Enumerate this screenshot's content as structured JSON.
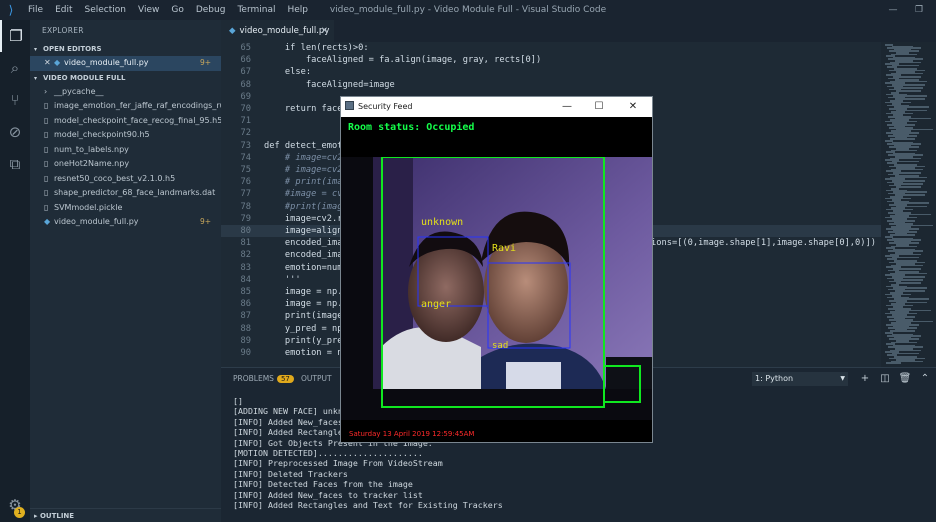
{
  "window": {
    "title": "video_module_full.py - Video Module Full - Visual Studio Code",
    "menu": [
      "File",
      "Edit",
      "Selection",
      "View",
      "Go",
      "Debug",
      "Terminal",
      "Help"
    ]
  },
  "sidebar": {
    "title": "EXPLORER",
    "open_editors_label": "OPEN EDITORS",
    "open_editor": {
      "name": "video_module_full.py",
      "badge": "9+"
    },
    "project_label": "VIDEO MODULE FULL",
    "items": [
      {
        "name": "__pycache__",
        "folder": true,
        "badge": ""
      },
      {
        "name": "image_emotion_fer_jaffe_raf_encodings_rus_4...",
        "folder": false,
        "badge": ""
      },
      {
        "name": "model_checkpoint_face_recog_final_95.h5",
        "folder": false,
        "badge": ""
      },
      {
        "name": "model_checkpoint90.h5",
        "folder": false,
        "badge": ""
      },
      {
        "name": "num_to_labels.npy",
        "folder": false,
        "badge": ""
      },
      {
        "name": "oneHot2Name.npy",
        "folder": false,
        "badge": ""
      },
      {
        "name": "resnet50_coco_best_v2.1.0.h5",
        "folder": false,
        "badge": ""
      },
      {
        "name": "shape_predictor_68_face_landmarks.dat",
        "folder": false,
        "badge": ""
      },
      {
        "name": "SVMmodel.pickle",
        "folder": false,
        "badge": ""
      },
      {
        "name": "video_module_full.py",
        "folder": false,
        "badge": "9+"
      }
    ],
    "outline_label": "OUTLINE",
    "settings_badge": "1"
  },
  "editor": {
    "tab_name": "video_module_full.py",
    "current_line": 80,
    "lines": [
      {
        "n": "65",
        "t": "    if len(rects)>0:"
      },
      {
        "n": "66",
        "t": "        faceAligned = fa.align(image, gray, rects[0])"
      },
      {
        "n": "67",
        "t": "    else:"
      },
      {
        "n": "68",
        "t": "        faceAligned=image"
      },
      {
        "n": "69",
        "t": ""
      },
      {
        "n": "70",
        "t": "    return faceAligned"
      },
      {
        "n": "71",
        "t": ""
      },
      {
        "n": "72",
        "t": ""
      },
      {
        "n": "73",
        "t": "def detect_emotion(image):"
      },
      {
        "n": "74",
        "t": "    # image=cv2.imread(image)"
      },
      {
        "n": "75",
        "t": "    # image=cv2.resize(image)"
      },
      {
        "n": "76",
        "t": "    # print(image.shape)"
      },
      {
        "n": "77",
        "t": "    #image = cv2.cvtColor(image)"
      },
      {
        "n": "78",
        "t": "    #print(image.shape)"
      },
      {
        "n": "79",
        "t": "    image=cv2.resize(image)"
      },
      {
        "n": "80",
        "t": "    image=align_face(image)"
      },
      {
        "n": "81",
        "t": "    encoded_image = face_recognition.face_encodings(image,known_face_locations=[(0,image.shape[1],image.shape[0],0)])"
      },
      {
        "n": "82",
        "t": "    encoded_image = np.array(encoded_image)"
      },
      {
        "n": "83",
        "t": "    emotion=num_to_labels"
      },
      {
        "n": "84",
        "t": "    '''"
      },
      {
        "n": "85",
        "t": "    image = np.expand_dims(image)"
      },
      {
        "n": "86",
        "t": "    image = np.expand_dims(image)"
      },
      {
        "n": "87",
        "t": "    print(image.shape)"
      },
      {
        "n": "88",
        "t": "    y_pred = np.argmax(model)"
      },
      {
        "n": "89",
        "t": "    print(y_pred)"
      },
      {
        "n": "90",
        "t": "    emotion = num_to_labels"
      }
    ]
  },
  "panel": {
    "problems_label": "PROBLEMS",
    "problems_count": "57",
    "output_label": "OUTPUT",
    "terminal_select": "1: Python",
    "terminal_lines": [
      "[]",
      "[ADDING NEW FACE] unknown",
      "[INFO] Added New_faces to tracker list",
      "[INFO] Added Rectangles and Text for Existing Trackers",
      "[INFO] Got Objects Present in the Image.",
      "[MOTION DETECTED].....................",
      "[INFO] Preprocessed Image From VideoStream",
      "[INFO] Deleted Trackers",
      "[INFO] Detected Faces from the image",
      "[INFO] Added New_faces to tracker list",
      "[INFO] Added Rectangles and Text for Existing Trackers"
    ]
  },
  "security_feed": {
    "title": "Security Feed",
    "room_status": "Room status:  Occupied",
    "label_unknown": "unknown",
    "label_anger": "anger",
    "label_ravi": "Ravi",
    "label_sad": "sad",
    "timestamp": "Saturday 13 April 2019 12:59:45AM",
    "colors": {
      "status": "#14ff4a",
      "box_green": "#10e820",
      "box_blue": "#2633ff",
      "label_yellow": "#e4e01a",
      "timestamp": "#ff2a2a"
    }
  }
}
